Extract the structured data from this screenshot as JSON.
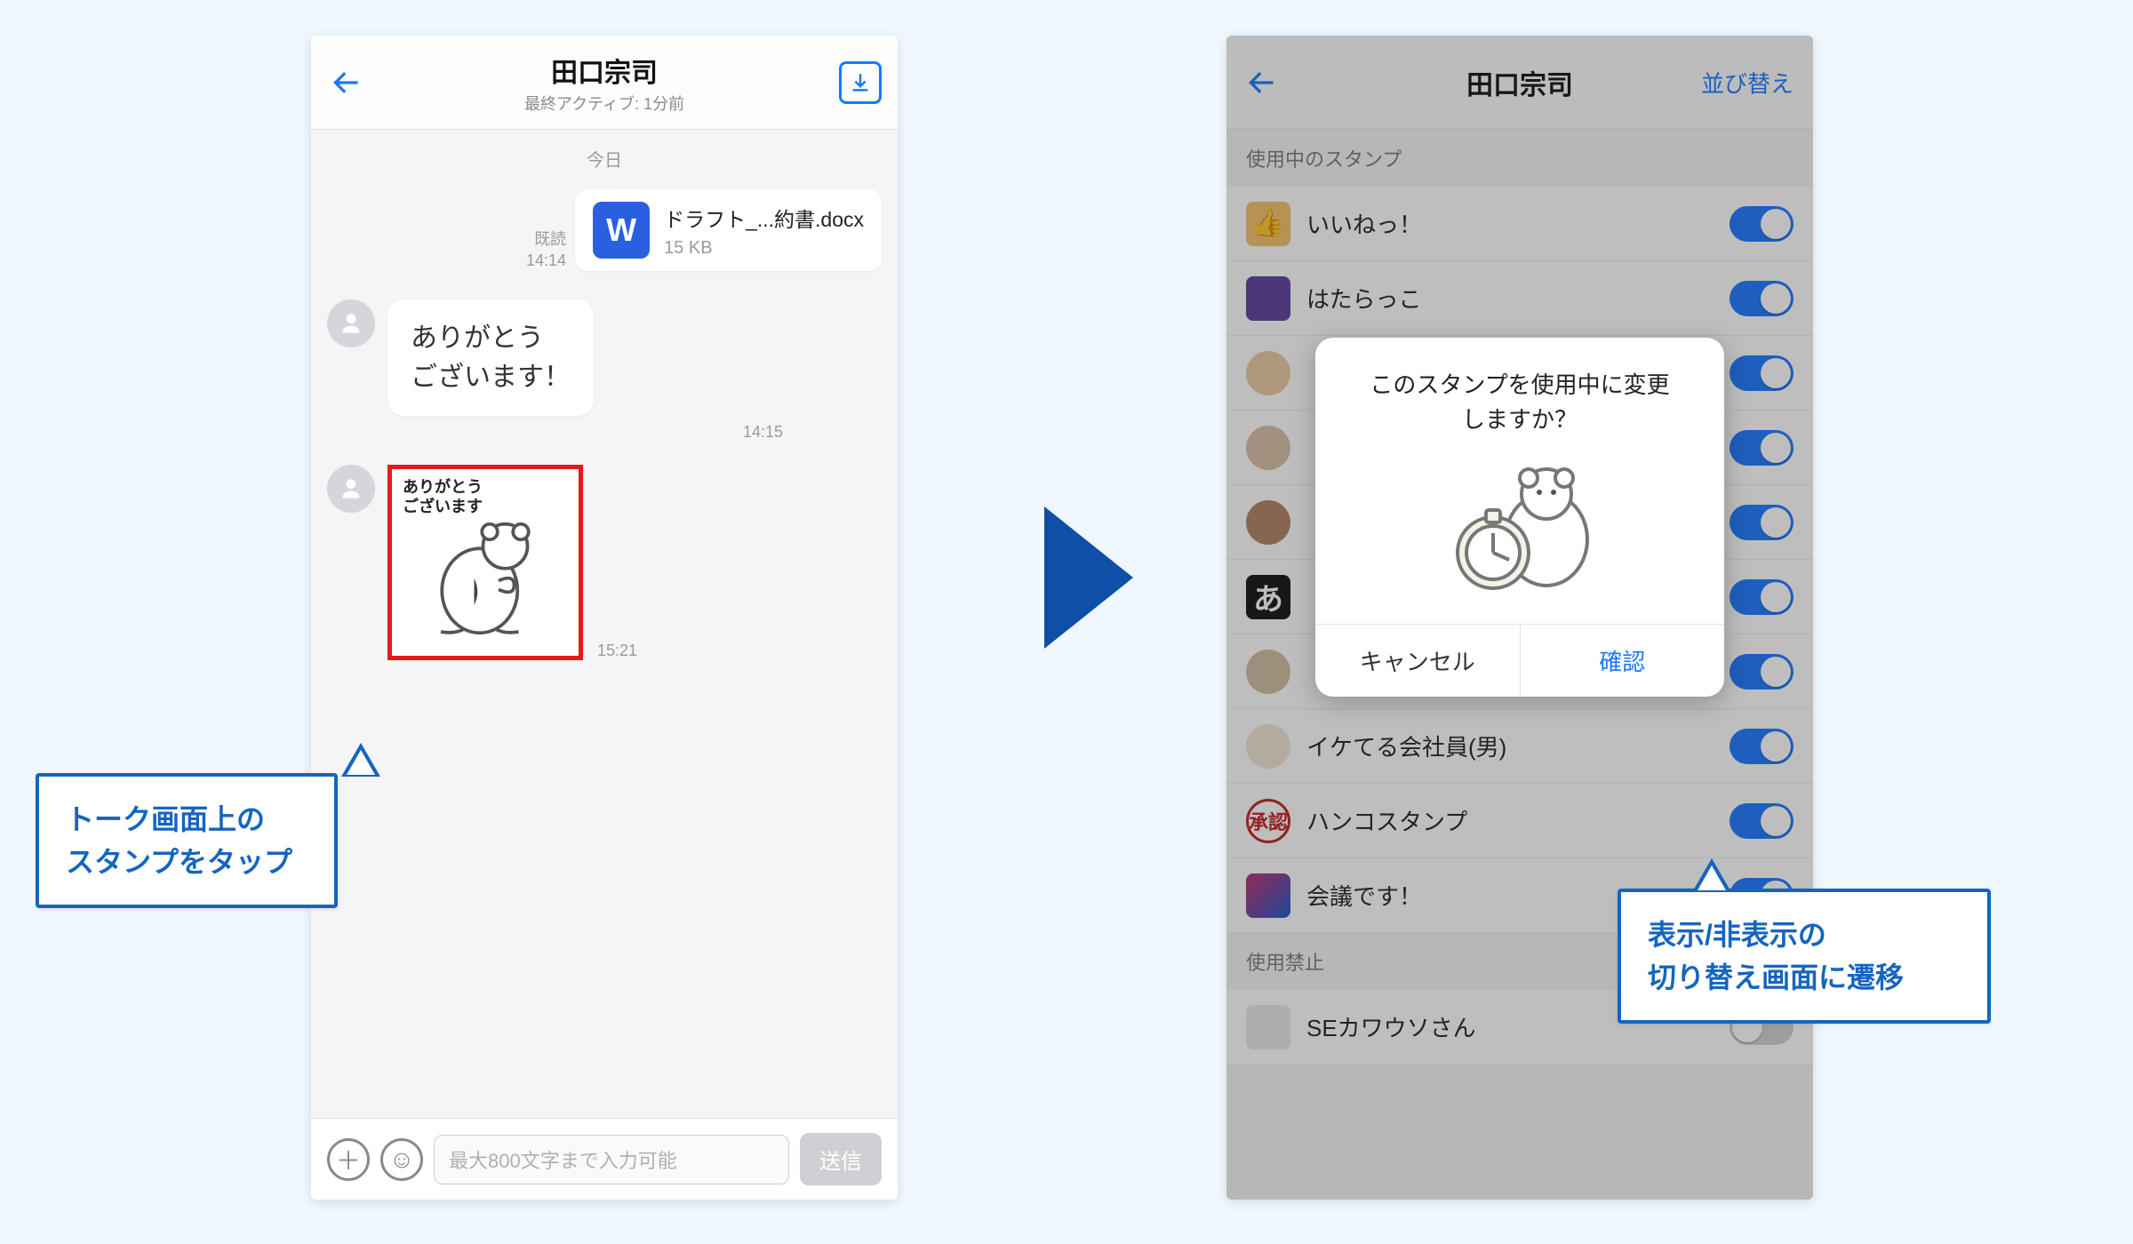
{
  "left": {
    "header": {
      "title": "田口宗司",
      "subtitle": "最終アクティブ: 1分前"
    },
    "dateSeparator": "今日",
    "fileMsg": {
      "read": "既読",
      "time": "14:14",
      "name": "ドラフト_...約書.docx",
      "size": "15 KB",
      "iconLetter": "W"
    },
    "textMsg": {
      "line1": "ありがとう",
      "line2": "ございます！",
      "time": "14:15"
    },
    "stickerMsg": {
      "caption1": "ありがとう",
      "caption2": "ございます",
      "time": "15:21"
    },
    "input": {
      "placeholder": "最大800文字まで入力可能",
      "send": "送信"
    }
  },
  "right": {
    "header": {
      "title": "田口宗司",
      "reorder": "並び替え"
    },
    "sectionActive": "使用中のスタンプ",
    "sectionDisabled": "使用禁止",
    "items": [
      {
        "label": "いいねっ！",
        "on": true,
        "iconClass": "ava-thumb",
        "glyph": "👍"
      },
      {
        "label": "はたらっこ",
        "on": true,
        "iconClass": "ava-dog",
        "glyph": ""
      },
      {
        "label": "",
        "on": true,
        "iconClass": "ava-1 ava-person",
        "glyph": ""
      },
      {
        "label": "",
        "on": true,
        "iconClass": "ava-3 ava-person",
        "glyph": ""
      },
      {
        "label": "",
        "on": true,
        "iconClass": "ava-4 ava-person",
        "glyph": ""
      },
      {
        "label": "",
        "on": true,
        "iconClass": "ava-5",
        "glyph": "あ"
      },
      {
        "label": "",
        "on": true,
        "iconClass": "ava-6 ava-person",
        "glyph": ""
      },
      {
        "label": "イケてる会社員(男)",
        "on": true,
        "iconClass": "ava-7 ava-person",
        "glyph": ""
      },
      {
        "label": "ハンコスタンプ",
        "on": true,
        "iconClass": "ava-stamp",
        "glyph": "承認"
      },
      {
        "label": "会議です！",
        "on": true,
        "iconClass": "ava-meeting",
        "glyph": ""
      }
    ],
    "disabledItems": [
      {
        "label": "SEカワウソさん",
        "on": false,
        "iconClass": "ava-otter",
        "glyph": ""
      }
    ],
    "modal": {
      "message1": "このスタンプを使用中に変更",
      "message2": "しますか？",
      "cancel": "キャンセル",
      "ok": "確認"
    }
  },
  "callouts": {
    "left1": "トーク画面上の",
    "left2": "スタンプをタップ",
    "right1": "表示/非表示の",
    "right2": "切り替え画面に遷移"
  }
}
